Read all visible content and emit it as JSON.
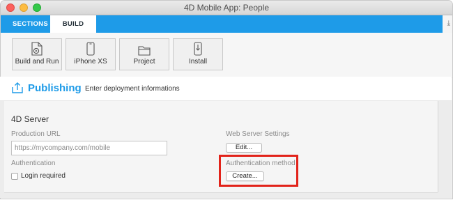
{
  "window": {
    "title": "4D Mobile App: People"
  },
  "tabs": [
    {
      "label": "SECTIONS",
      "active": false
    },
    {
      "label": "BUILD",
      "active": true
    }
  ],
  "toolbar": {
    "buttons": [
      {
        "label": "Build and Run",
        "icon": "build-run-icon"
      },
      {
        "label": "iPhone XS",
        "icon": "iphone-icon"
      },
      {
        "label": "Project",
        "icon": "folder-icon"
      },
      {
        "label": "Install",
        "icon": "install-icon"
      }
    ]
  },
  "section": {
    "title": "Publishing",
    "subtitle": "Enter deployment informations"
  },
  "server": {
    "title": "4D Server",
    "production_url_label": "Production URL",
    "production_url_value": "",
    "production_url_placeholder": "https://mycompany.com/mobile",
    "authentication_label": "Authentication",
    "login_required_label": "Login required",
    "login_required_checked": false,
    "web_server_settings_label": "Web Server Settings",
    "edit_button": "Edit...",
    "auth_method_label": "Authentication method",
    "create_button": "Create..."
  },
  "colors": {
    "accent": "#1e9be8",
    "highlight": "#e2231a"
  }
}
